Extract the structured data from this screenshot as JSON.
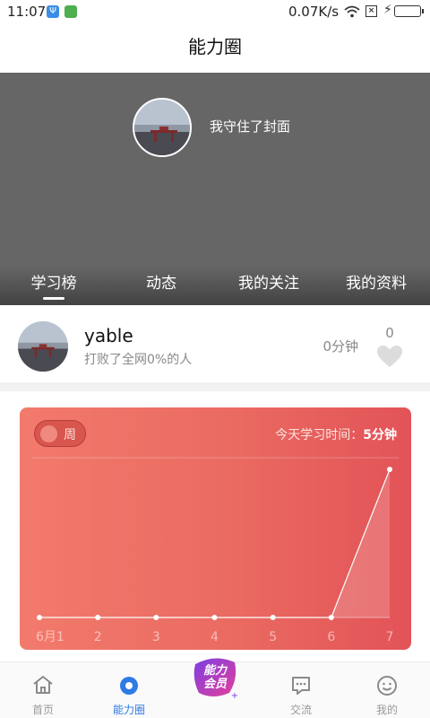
{
  "status": {
    "time": "11:07",
    "speed": "0.07K/s",
    "usb_glyph": "Ψ"
  },
  "title": "能力圈",
  "cover": {
    "text": "我守住了封面"
  },
  "tabs": [
    "学习榜",
    "动态",
    "我的关注",
    "我的资料"
  ],
  "active_tab": 0,
  "user": {
    "name": "yable",
    "subtitle": "打败了全网0%的人",
    "minutes": "0分钟",
    "likes": "0"
  },
  "card": {
    "toggle_label": "周",
    "today_label": "今天学习时间：",
    "today_value": "5分钟"
  },
  "chart_data": {
    "type": "area",
    "x": [
      "6月1",
      "2",
      "3",
      "4",
      "5",
      "6",
      "7"
    ],
    "values": [
      0,
      0,
      0,
      0,
      0,
      0,
      5
    ]
  },
  "nav": [
    {
      "label": "首页",
      "icon": "home-icon"
    },
    {
      "label": "能力圈",
      "icon": "circle-icon"
    },
    {
      "label": "",
      "icon": "vip-badge-icon",
      "badge_text": [
        "能力",
        "会员"
      ]
    },
    {
      "label": "交流",
      "icon": "chat-icon"
    },
    {
      "label": "我的",
      "icon": "smile-icon"
    }
  ],
  "colors": {
    "accent": "#2e7be5",
    "card_start": "#f27a6c",
    "card_end": "#e25358",
    "cover": "#666666"
  }
}
